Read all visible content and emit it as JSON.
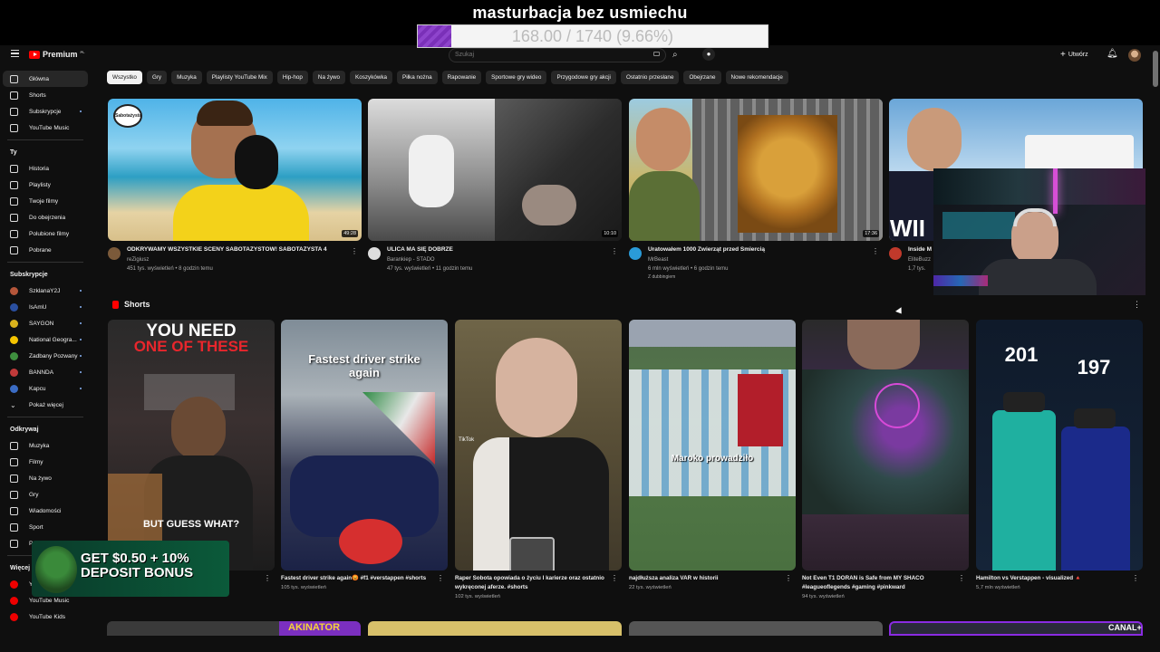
{
  "overlay": {
    "title": "masturbacja bez usmiechu",
    "progress_text": "168.00 / 1740 (9.66%)",
    "progress_fraction": 0.0966,
    "fill_color": "#7a30b8"
  },
  "header": {
    "logo_label": "Premium",
    "logo_badge": "PL",
    "search_placeholder": "Szukaj",
    "create_label": "Utwórz"
  },
  "sidebar": {
    "main": [
      {
        "label": "Główna",
        "icon": "home-icon",
        "active": true
      },
      {
        "label": "Shorts",
        "icon": "shorts-icon"
      },
      {
        "label": "Subskrypcje",
        "icon": "subscriptions-icon"
      },
      {
        "label": "YouTube Music",
        "icon": "music-icon"
      }
    ],
    "you_heading": "Ty",
    "you": [
      {
        "label": "Historia",
        "icon": "history-icon"
      },
      {
        "label": "Playlisty",
        "icon": "playlist-icon"
      },
      {
        "label": "Twoje filmy",
        "icon": "your-videos-icon"
      },
      {
        "label": "Do obejrzenia",
        "icon": "watch-later-icon"
      },
      {
        "label": "Polubione filmy",
        "icon": "liked-icon"
      },
      {
        "label": "Pobrane",
        "icon": "download-icon"
      }
    ],
    "subs_heading": "Subskrypcje",
    "subs": [
      {
        "label": "SzklanaY2J",
        "color": "#b5563a"
      },
      {
        "label": "IsAmU",
        "color": "#2a4fa0"
      },
      {
        "label": "SAYGON",
        "color": "#d9b21c"
      },
      {
        "label": "National Geogra...",
        "color": "#f5c400"
      },
      {
        "label": "Zadbany Pozwany",
        "color": "#3e8f3e"
      },
      {
        "label": "BANNDA",
        "color": "#c13a3a"
      },
      {
        "label": "Kapcu",
        "color": "#3b6cc4"
      }
    ],
    "show_more": "Pokaż więcej",
    "explore_heading": "Odkrywaj",
    "explore": [
      {
        "label": "Muzyka",
        "icon": "music-note-icon"
      },
      {
        "label": "Filmy",
        "icon": "film-icon"
      },
      {
        "label": "Na żywo",
        "icon": "live-icon"
      },
      {
        "label": "Gry",
        "icon": "gaming-icon"
      },
      {
        "label": "Wiadomości",
        "icon": "news-icon"
      },
      {
        "label": "Sport",
        "icon": "trophy-icon"
      },
      {
        "label": "P",
        "icon": "podcast-icon"
      }
    ],
    "more_heading": "Więcej z",
    "more": [
      {
        "label": "YouTube Music"
      },
      {
        "label": "YouTube Music"
      },
      {
        "label": "YouTube Kids"
      }
    ]
  },
  "chips": [
    "Wszystko",
    "Gry",
    "Muzyka",
    "Playlisty YouTube Mix",
    "Hip-hop",
    "Na żywo",
    "Koszykówka",
    "Piłka nożna",
    "Rapowanie",
    "Sportowe gry wideo",
    "Przygodowe gry akcji",
    "Ostatnio przesłane",
    "Obejrzane",
    "Nowe rekomendacje"
  ],
  "videos": [
    {
      "title": "ODKRYWAMY WSZYSTKIE SCENY SABOTAŻYSTÓW! SABOTAŻYSTA 4",
      "channel": "reZigiusz",
      "meta": "451 tys. wyświetleń • 8 godzin temu",
      "duration": "49:28"
    },
    {
      "title": "ULICA MA SIĘ DOBRZE",
      "channel": "Barankiep - STADO",
      "meta": "47 tys. wyświetleń • 11 godzin temu",
      "duration": "10:10"
    },
    {
      "title": "Uratowałem 1000 Zwierząt przed Śmiercią",
      "channel": "MrBeast",
      "meta": "6 mln wyświetleń • 6 godzin temu",
      "extra": "Z dubbingiem",
      "duration": "17:36"
    },
    {
      "title": "Inside M",
      "channel": "EliteBuzz",
      "meta": "1,7 tys.",
      "duration": ""
    }
  ],
  "thumb_text": {
    "badge": "Sabotażysta",
    "win": "WII"
  },
  "shorts_heading": "Shorts",
  "shorts": [
    {
      "title": "the",
      "meta": "1,5 mln wyświetleń",
      "overlay1": "YOU NEED",
      "overlay2": "ONE OF THESE",
      "overlay3": "BUT GUESS WHAT?"
    },
    {
      "title": "Fastest driver strike again😡 #f1 #verstappen #shorts",
      "meta": "105 tys. wyświetleń",
      "overlay1": "Fastest driver strike again"
    },
    {
      "title": "Raper Sobota opowiada o życiu I karierze oraz ostatnio wykręconej aferze. #shorts",
      "meta": "102 tys. wyświetleń",
      "overlay1": "TikTok"
    },
    {
      "title": "najdłuższa analiza VAR w historii",
      "meta": "22 tys. wyświetleń",
      "overlay1": "Maroko prowadziło"
    },
    {
      "title": "Not Even T1 DORAN is Safe from MY SHACO #leagueoflegends #gaming #pinkward",
      "meta": "94 tys. wyświetleń",
      "overlay1": ""
    },
    {
      "title": "Hamilton vs Verstappen - visualized 🔺",
      "meta": "5,7 mln wyświetleń",
      "overlay1": "201",
      "overlay2": "197"
    }
  ],
  "promo": {
    "text": "GET $0.50 + 10% DEPOSIT BONUS"
  },
  "bottom": {
    "akinator": "AKINATOR",
    "canal": "CANAL+"
  }
}
